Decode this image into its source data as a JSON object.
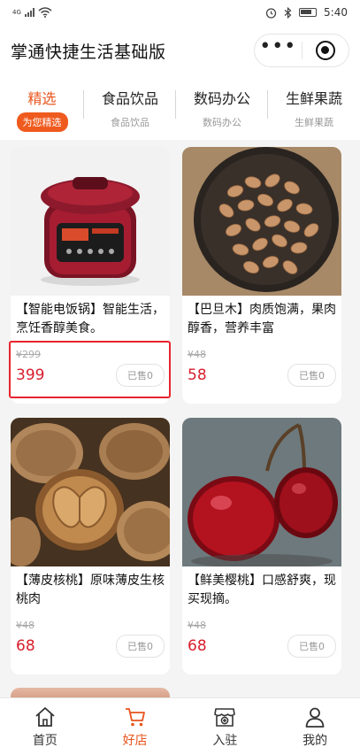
{
  "status_bar": {
    "network": "4G",
    "time": "5:40"
  },
  "header": {
    "title": "掌通快捷生活基础版",
    "menu_icon": "more-dots-icon",
    "close_icon": "target-icon"
  },
  "tabs": [
    {
      "label": "精选",
      "sub": "为您精选",
      "active": true
    },
    {
      "label": "食品饮品",
      "sub": "食品饮品",
      "active": false
    },
    {
      "label": "数码办公",
      "sub": "数码办公",
      "active": false
    },
    {
      "label": "生鲜果蔬",
      "sub": "生鲜果蔬",
      "active": false
    }
  ],
  "products": [
    {
      "name": "【智能电饭锅】智能生活，烹饪香醇美食。",
      "original_price": "¥299",
      "price": "399",
      "sold": "已售0"
    },
    {
      "name": "【巴旦木】肉质饱满，果肉醇香，营养丰富",
      "original_price": "¥48",
      "price": "58",
      "sold": "已售0"
    },
    {
      "name": "【薄皮核桃】原味薄皮生核桃肉",
      "original_price": "¥48",
      "price": "68",
      "sold": "已售0"
    },
    {
      "name": "【鲜美樱桃】口感舒爽，现买现摘。",
      "original_price": "¥48",
      "price": "68",
      "sold": "已售0"
    }
  ],
  "bottom_nav": [
    {
      "label": "首页",
      "icon": "home-icon",
      "active": false
    },
    {
      "label": "好店",
      "icon": "cart-icon",
      "active": true
    },
    {
      "label": "入驻",
      "icon": "store-add-icon",
      "active": false
    },
    {
      "label": "我的",
      "icon": "user-icon",
      "active": false
    }
  ],
  "colors": {
    "accent": "#e8541c",
    "price": "#d81e2c",
    "highlight_border": "#e8242c"
  }
}
